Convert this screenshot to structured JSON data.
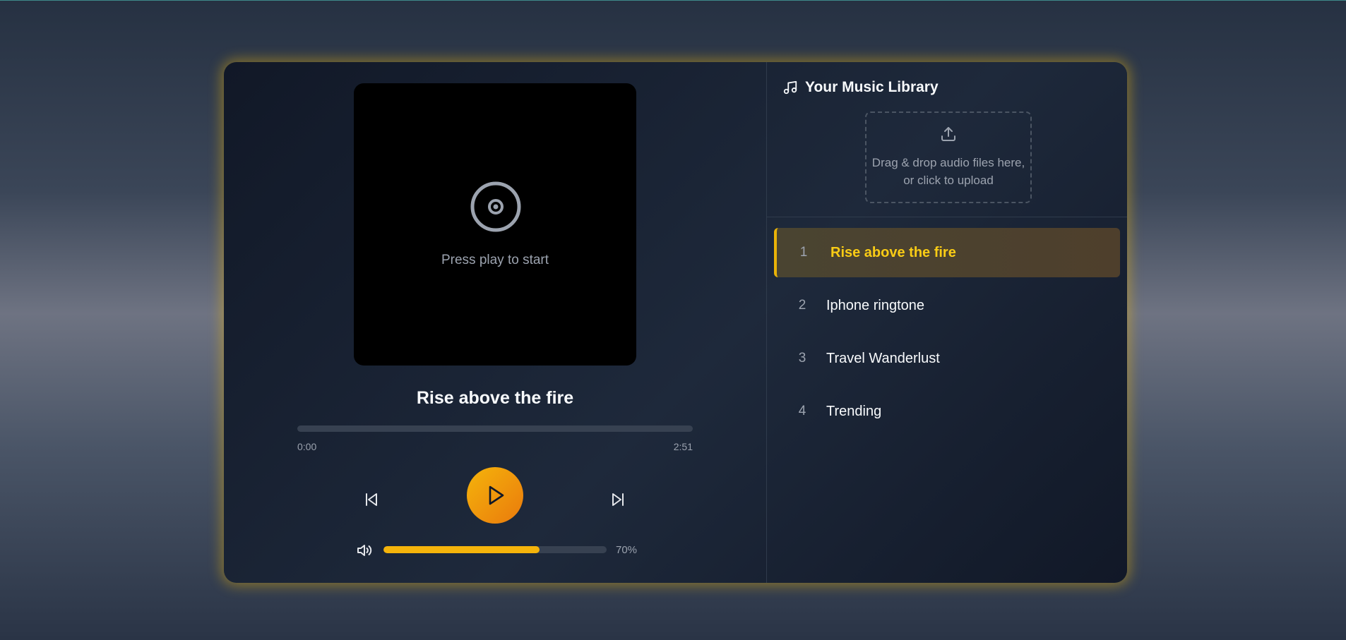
{
  "player": {
    "placeholder_text": "Press play to start",
    "current_title": "Rise above the fire",
    "progress": 0,
    "time_current": "0:00",
    "time_total": "2:51",
    "volume": 0.7,
    "volume_text": "70%",
    "icons": {
      "artwork": "disc-icon",
      "previous": "skip-back-icon",
      "play": "play-icon",
      "next": "skip-forward-icon",
      "volume": "volume-icon"
    }
  },
  "library": {
    "title": "Your Music Library",
    "title_icon": "music-note-icon",
    "upload_icon": "upload-icon",
    "upload_text": "Drag & drop audio files here, or click to upload",
    "tracks": [
      {
        "number": "1",
        "name": "Rise above the fire",
        "active": true
      },
      {
        "number": "2",
        "name": "Iphone ringtone",
        "active": false
      },
      {
        "number": "3",
        "name": "Travel Wanderlust",
        "active": false
      },
      {
        "number": "4",
        "name": "Trending",
        "active": false
      }
    ]
  },
  "colors": {
    "accent": "#eab308",
    "accent_text": "#facc15",
    "background": "#1e293b"
  }
}
